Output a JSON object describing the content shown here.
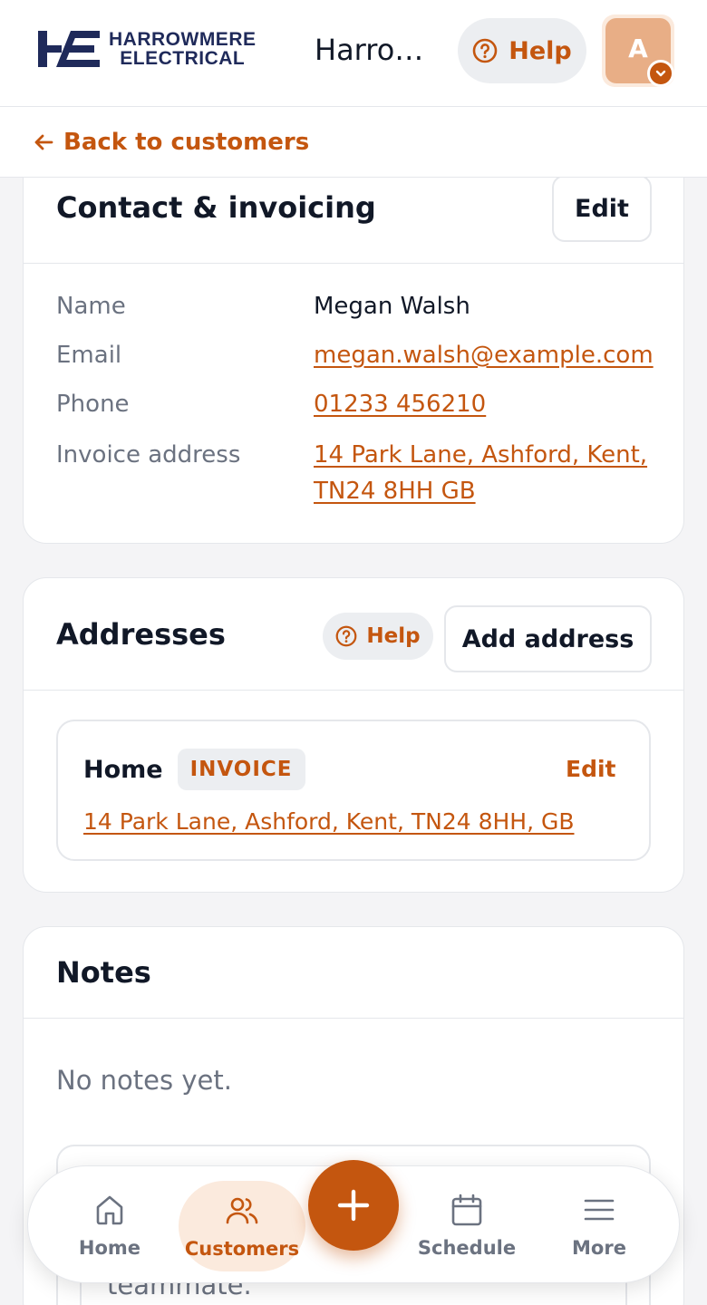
{
  "header": {
    "logo_line1": "HARROWMERE",
    "logo_line2": "ELECTRICAL",
    "brand_name": "Harrowmere Electrical",
    "help_label": "Help",
    "avatar_initial": "A"
  },
  "subheader": {
    "back_label": "Back to customers"
  },
  "contact": {
    "title": "Contact & invoicing",
    "edit_label": "Edit",
    "fields": [
      {
        "label": "Name",
        "value": "Megan Walsh"
      },
      {
        "label": "Email",
        "value": "megan.walsh@example.com"
      },
      {
        "label": "Phone",
        "value": "01233 456210"
      },
      {
        "label": "Invoice address",
        "value_line1": "14 Park Lane, Ashford, Kent,",
        "value_line2": "TN24 8HH GB"
      }
    ]
  },
  "addresses": {
    "title": "Addresses",
    "help_label": "Help",
    "add_label": "Add address",
    "items": [
      {
        "name": "Home",
        "tag": "INVOICE",
        "edit_label": "Edit",
        "address": "14 Park Lane, Ashford, Kent, TN24 8HH, GB"
      }
    ]
  },
  "notes": {
    "title": "Notes",
    "empty_text": "No notes yet.",
    "partial_text": "teammate."
  },
  "nav": {
    "items": [
      {
        "label": "Home",
        "icon": "home-icon",
        "active": false
      },
      {
        "label": "Customers",
        "icon": "users-icon",
        "active": true
      },
      {
        "label": "Schedule",
        "icon": "calendar-icon",
        "active": false
      },
      {
        "label": "More",
        "icon": "menu-icon",
        "active": false
      }
    ],
    "fab_icon": "plus-icon"
  },
  "colors": {
    "accent": "#c4560f",
    "brand_navy": "#1f2a5a",
    "muted_text": "#6b7280",
    "pill_bg": "#eceef1",
    "active_nav_bg": "#fbeadd"
  }
}
